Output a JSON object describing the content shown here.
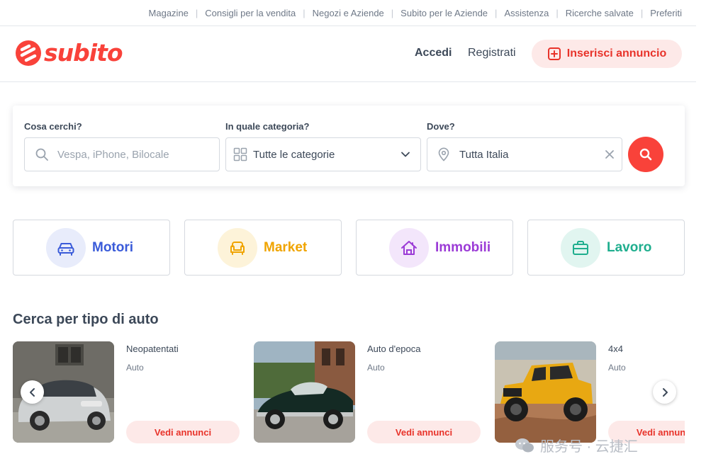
{
  "topnav": {
    "links": [
      "Magazine",
      "Consigli per la vendita",
      "Negozi e Aziende",
      "Subito per le Aziende",
      "Assistenza",
      "Ricerche salvate",
      "Preferiti"
    ],
    "separator": "|"
  },
  "header": {
    "logo_text": "subito",
    "login": "Accedi",
    "register": "Registrati",
    "post_ad": "Inserisci annuncio"
  },
  "search": {
    "what_label": "Cosa cerchi?",
    "what_placeholder": "Vespa, iPhone, Bilocale",
    "category_label": "In quale categoria?",
    "category_value": "Tutte le categorie",
    "where_label": "Dove?",
    "where_value": "Tutta Italia"
  },
  "categories": [
    {
      "label": "Motori",
      "color": "#3a5bd9",
      "bg": "#e8ecfb",
      "icon": "car-icon"
    },
    {
      "label": "Market",
      "color": "#f0a400",
      "bg": "#fdf3d9",
      "icon": "armchair-icon"
    },
    {
      "label": "Immobili",
      "color": "#9b3bd6",
      "bg": "#f3e6fb",
      "icon": "house-icon"
    },
    {
      "label": "Lavoro",
      "color": "#1fae8e",
      "bg": "#e1f5f0",
      "icon": "briefcase-icon"
    }
  ],
  "section": {
    "title": "Cerca per tipo di auto"
  },
  "car_types": [
    {
      "title": "Neopatentati",
      "subtitle": "Auto",
      "cta": "Vedi annunci"
    },
    {
      "title": "Auto d'epoca",
      "subtitle": "Auto",
      "cta": "Vedi annunci"
    },
    {
      "title": "4x4",
      "subtitle": "Auto",
      "cta": "Vedi annunci"
    }
  ],
  "watermark": {
    "text": "服务号 · 云捷汇"
  },
  "colors": {
    "brand": "#f9423a",
    "brand_soft": "#fde9e8",
    "text": "#3c4858",
    "muted": "#6e7887"
  }
}
